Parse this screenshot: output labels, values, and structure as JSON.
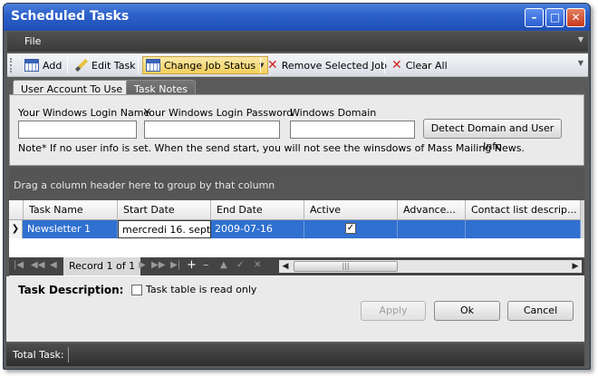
{
  "window": {
    "title": "Scheduled Tasks"
  },
  "menu": {
    "file": "File"
  },
  "toolbar": {
    "add": "Add",
    "edit_task": "Edit Task",
    "change_job_status": "Change Job Status",
    "remove_selected_job": "Remove Selected Job",
    "clear_all": "Clear All"
  },
  "tabs": [
    {
      "label": "User Account To Use",
      "active": true
    },
    {
      "label": "Task Notes",
      "active": false
    }
  ],
  "account": {
    "login_name_label": "Your Windows Login Name",
    "login_password_label": "Your Windows Login Password",
    "domain_label": "Windows Domain",
    "login_name_value": "",
    "login_password_value": "",
    "domain_value": "",
    "detect_button": "Detect Domain and User Info",
    "note": "Note* If no user info is set. When the send start, you will not see the winsdows of Mass Mailing News."
  },
  "grid": {
    "group_hint": "Drag a column header here to group by that column",
    "columns": [
      "Task Name",
      "Start Date",
      "End Date",
      "Active",
      "Advance...",
      "Contact list descrip..."
    ],
    "rows": [
      {
        "task_name": "Newsletter 1",
        "start_date": "mercredi 16. sept...",
        "end_date": "2009-07-16",
        "active": true,
        "advance": "",
        "contact_list": ""
      }
    ],
    "record_label": "Record 1 of 1"
  },
  "bottom": {
    "task_description_label": "Task Description:",
    "read_only_label": "Task table is read only",
    "read_only_checked": false,
    "apply": "Apply",
    "ok": "Ok",
    "cancel": "Cancel"
  },
  "status": {
    "total_task": "Total Task:"
  },
  "colors": {
    "title_bar": "#2b5fc8",
    "selection": "#3070d0",
    "dark_panel": "#555555"
  }
}
